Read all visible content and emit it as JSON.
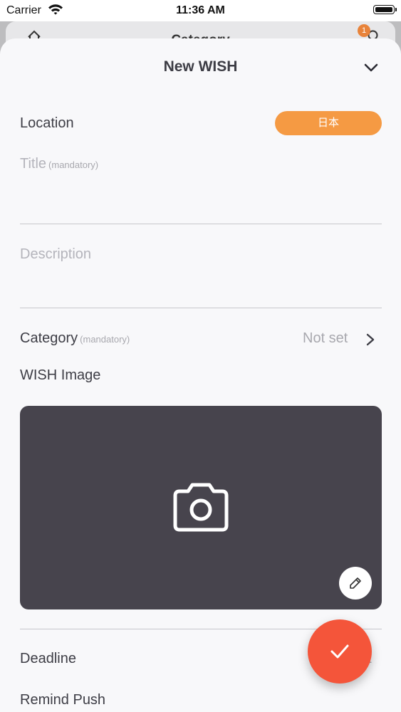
{
  "status_bar": {
    "carrier": "Carrier",
    "time": "11:36 AM"
  },
  "background_page": {
    "title": "Category",
    "badge_count": "1"
  },
  "sheet": {
    "title": "New WISH",
    "location": {
      "label": "Location",
      "value": "日本"
    },
    "title_field": {
      "label": "Title",
      "mandatory": "(mandatory)"
    },
    "description_field": {
      "placeholder": "Description"
    },
    "category": {
      "label": "Category",
      "mandatory": "(mandatory)",
      "value": "Not set"
    },
    "wish_image": {
      "label": "WISH Image"
    },
    "deadline": {
      "label": "Deadline",
      "value": "et"
    },
    "remind_push": {
      "label": "Remind Push"
    }
  },
  "icons": {
    "wifi": "wifi-icon",
    "battery": "battery-icon",
    "home": "home-icon",
    "search": "search-icon",
    "close": "chevron-down-icon",
    "chevron": "chevron-right-icon",
    "camera": "camera-icon",
    "edit": "pencil-icon",
    "confirm": "check-icon"
  },
  "colors": {
    "accent_orange": "#f59a43",
    "fab_red": "#f4553a",
    "image_bg": "#47444d",
    "badge": "#e8833a"
  }
}
